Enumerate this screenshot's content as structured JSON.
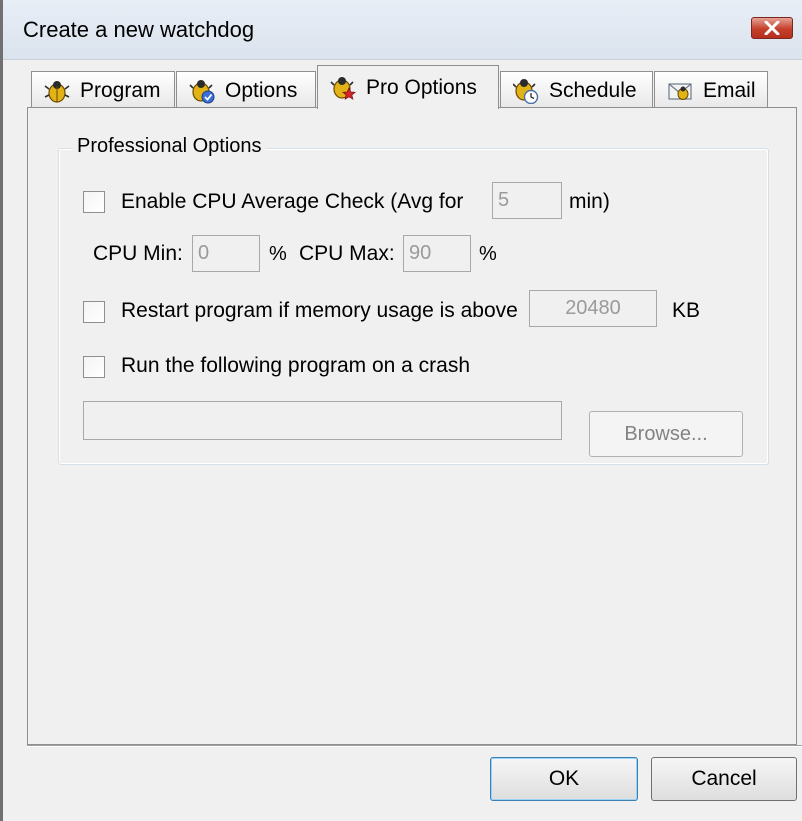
{
  "window": {
    "title": "Create a new watchdog"
  },
  "tabs": [
    {
      "label": "Program",
      "icon": "bug-icon"
    },
    {
      "label": "Options",
      "icon": "bug-check-icon"
    },
    {
      "label": "Pro Options",
      "icon": "bug-star-icon",
      "active": true
    },
    {
      "label": "Schedule",
      "icon": "bug-clock-icon"
    },
    {
      "label": "Email",
      "icon": "email-icon"
    }
  ],
  "pro_options": {
    "group_title": "Professional Options",
    "cpu_check": {
      "label": "Enable CPU Average Check (Avg for",
      "minutes": "5",
      "minutes_unit": "min)",
      "checked": false,
      "cpu_min_label": "CPU Min:",
      "cpu_min": "0",
      "cpu_max_label": "CPU Max:",
      "cpu_max": "90",
      "percent": "%"
    },
    "memory": {
      "label": "Restart program if memory usage is above",
      "value": "20480",
      "unit": "KB",
      "checked": false
    },
    "crash": {
      "label": "Run the following program on a crash",
      "path": "",
      "checked": false,
      "browse_label": "Browse..."
    }
  },
  "buttons": {
    "ok": "OK",
    "cancel": "Cancel"
  },
  "colors": {
    "close_button": "#c4402b",
    "disabled_text": "#9a9a9a"
  }
}
